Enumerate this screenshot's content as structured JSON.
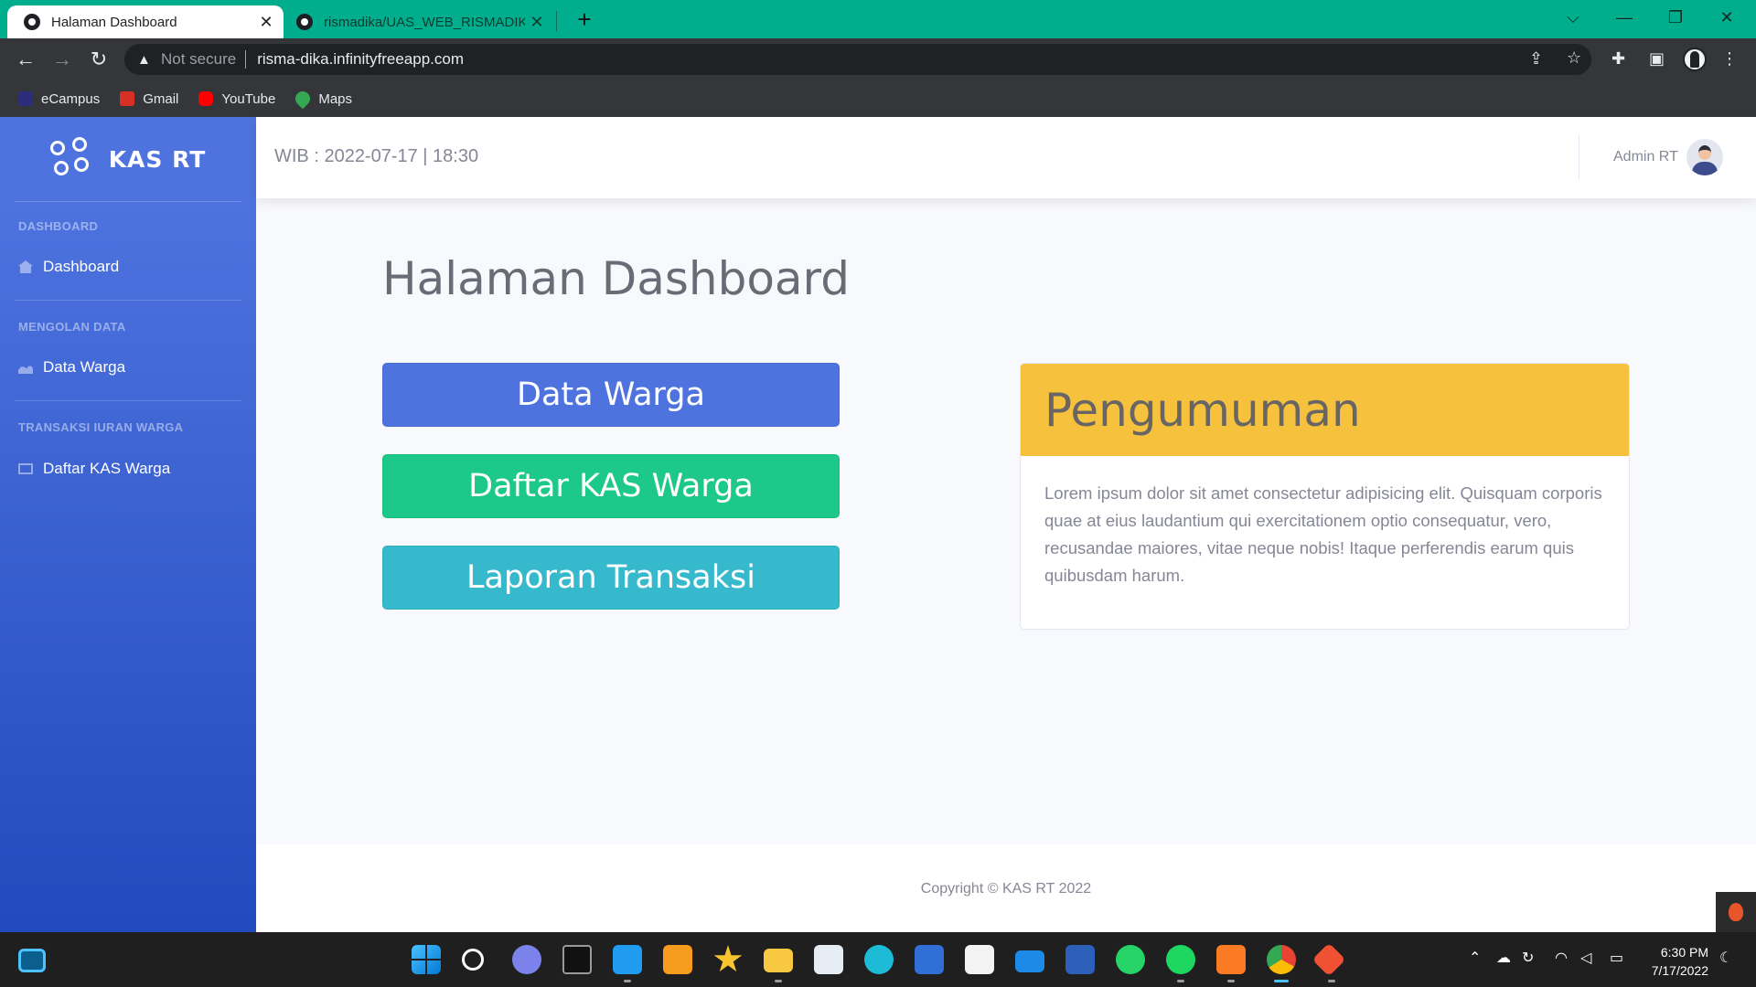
{
  "browser": {
    "tabs": [
      {
        "title": "Halaman Dashboard",
        "close": "✕"
      },
      {
        "title": "rismadika/UAS_WEB_RISMADIKA",
        "close": "✕"
      }
    ],
    "new_tab": "+",
    "window_controls": {
      "dropdown": "⌵",
      "minimize": "—",
      "restore": "❐",
      "close": "✕"
    },
    "nav": {
      "back": "←",
      "forward": "→",
      "reload": "↻"
    },
    "security_label": "Not secure",
    "url": "risma-dika.infinityfreeapp.com",
    "bookmarks": [
      {
        "label": "eCampus",
        "color": "#2b2d7a"
      },
      {
        "label": "Gmail",
        "color": "#d93025"
      },
      {
        "label": "YouTube",
        "color": "#ff0000"
      },
      {
        "label": "Maps",
        "color": "#34a853"
      }
    ]
  },
  "sidebar": {
    "brand": "KAS RT",
    "sections": [
      {
        "heading": "DASHBOARD",
        "item": "Dashboard",
        "icon": "home-icon"
      },
      {
        "heading": "MENGOLAN DATA",
        "item": "Data Warga",
        "icon": "users-icon"
      },
      {
        "heading": "TRANSAKSI IURAN WARGA",
        "item": "Daftar KAS Warga",
        "icon": "list-icon"
      }
    ]
  },
  "topbar": {
    "datetime": "WIB : 2022-07-17 | 18:30",
    "user": "Admin RT"
  },
  "main": {
    "title": "Halaman Dashboard",
    "buttons": [
      "Data Warga",
      "Daftar KAS Warga",
      "Laporan Transaksi"
    ],
    "announcement": {
      "title": "Pengumuman",
      "body": "Lorem ipsum dolor sit amet consectetur adipisicing elit. Quisquam corporis quae at eius laudantium qui exercitationem optio consequatur, vero, recusandae maiores, vitae neque nobis! Itaque perferendis earum quis quibusdam harum."
    }
  },
  "footer": {
    "copyright": "Copyright © KAS RT 2022"
  },
  "colors": {
    "primary": "#4e73df",
    "success": "#1cc88a",
    "info": "#36b9cc",
    "warning": "#f6c23e",
    "browser_accent": "#00ae8e"
  },
  "taskbar": {
    "time": "6:30 PM",
    "date": "7/17/2022",
    "apps": [
      "start-icon",
      "search-icon",
      "teams-icon",
      "notion-icon",
      "vscode-icon",
      "sublime-icon",
      "star-app-icon",
      "file-explorer-icon",
      "notepad-icon",
      "edge-icon",
      "dev-icon",
      "store-icon",
      "mail-icon",
      "word-icon",
      "whatsapp-icon",
      "spotify-icon",
      "xampp-icon",
      "chrome-icon",
      "git-icon"
    ]
  }
}
